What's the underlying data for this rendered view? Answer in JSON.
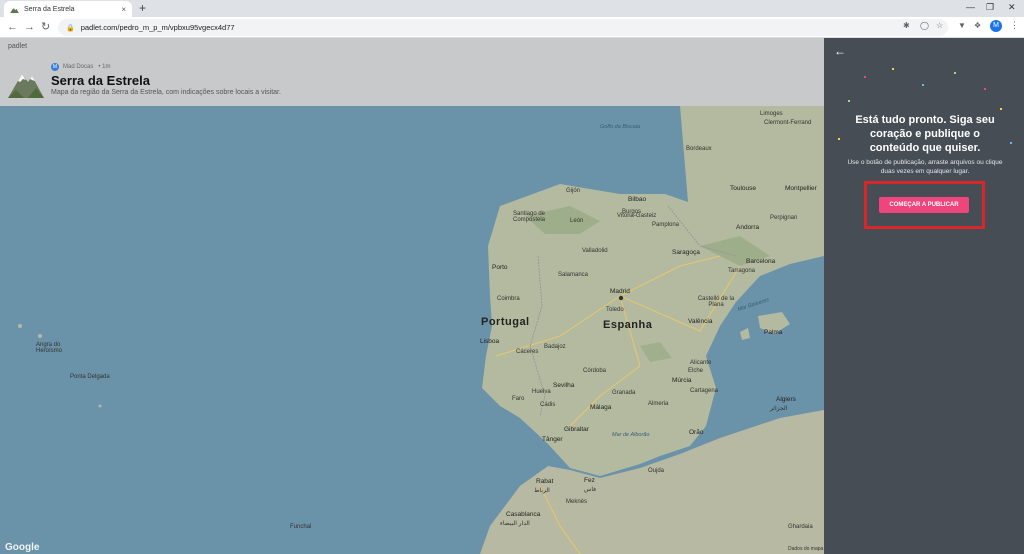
{
  "browser": {
    "tab_title": "Serra da Estrela",
    "tab_close": "×",
    "new_tab": "+",
    "url": "padlet.com/pedro_m_p_m/vpbxu95vgecx4d77",
    "profile_initial": "M"
  },
  "page": {
    "brand": "padlet",
    "author": "Mad Docas",
    "author_initial": "M",
    "time": "• 1m",
    "title": "Serra da Estrela",
    "subtitle": "Mapa da região da Serra da Estrela, com indicações sobre locais a visitar.",
    "google": "Google"
  },
  "map_labels": {
    "golfo": "Golfo da Biscaia",
    "gijon": "Gijón",
    "bilbao": "Bilbao",
    "santiago": "Santiago de Compostela",
    "leon": "León",
    "vitoria": "Vitoria-Gasteiz",
    "pamplona": "Pamplona",
    "andorra": "Andorra",
    "toulouse": "Toulouse",
    "montpellier": "Montpellier",
    "limoges": "Limoges",
    "clermont": "Clermont-Ferrand",
    "bordeaux": "Bordeaux",
    "valladolid": "Valladolid",
    "zaragoza": "Saragoça",
    "barcelona": "Barcelona",
    "tarragona": "Tarragona",
    "porto": "Porto",
    "salamanca": "Salamanca",
    "madrid": "Madrid",
    "coimbra": "Coimbra",
    "portugal": "Portugal",
    "espanha": "Espanha",
    "toledo": "Toledo",
    "valencia": "Valência",
    "lisboa": "Lisboa",
    "badajoz": "Badajoz",
    "palma": "Palma",
    "mar_baleares": "Mar Baleares",
    "cordoba": "Córdoba",
    "sevilha": "Sevilha",
    "murcia": "Múrcia",
    "malaga": "Málaga",
    "granada": "Granada",
    "almeria": "Almeria",
    "gibraltar": "Gibraltar",
    "tanger": "Tânger",
    "mar_alboran": "Mar de Alborão",
    "algiers": "Algiers",
    "algiers_ar": "الجزائر",
    "orao": "Orão",
    "rabat": "Rabat",
    "rabat_ar": "الرباط",
    "fez": "Fez",
    "fez_ar": "فاس",
    "casablanca": "Casablanca",
    "casablanca_ar": "الدار البيضاء",
    "meknes": "Meknès",
    "oujda": "Oujda",
    "funchal": "Funchal",
    "ponta_delgada": "Ponta Delgada",
    "angra": "Angra do Heroísmo",
    "huelva": "Huelva",
    "faro": "Faro",
    "cadiz": "Cádis",
    "alicante": "Alicante",
    "elche": "Elche",
    "cartagena": "Cartagena",
    "burgos": "Burgos",
    "caceres": "Cáceres",
    "castellon": "Castelló de la Plana",
    "perpignan": "Perpignan",
    "ghardaia": "Ghardaia",
    "dados": "Dados do mapa"
  },
  "panel": {
    "back": "←",
    "title": "Está tudo pronto. Siga seu coração e publique o conteúdo que quiser.",
    "description": "Use o botão de publicação, arraste arquivos ou clique duas vezes em qualquer lugar.",
    "publish_button": "COMEÇAR A PUBLICAR"
  },
  "colors": {
    "panel_bg": "#474d55",
    "button": "#f0457a",
    "highlight": "#d9262a",
    "sea": "#6a92a8",
    "land": "#b9bea9"
  }
}
